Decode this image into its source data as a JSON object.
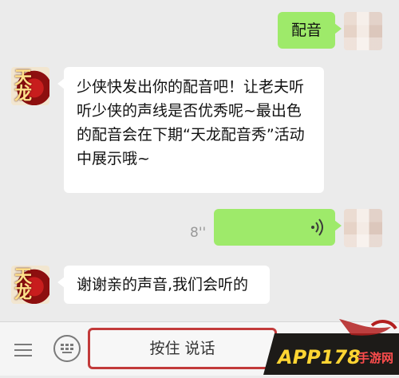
{
  "messages": {
    "m1_text": "配音",
    "m2_text": "少侠快发出你的配音吧！让老夫听听少侠的声线是否优秀呢~最出色的配音会在下期“天龙配音秀”活动中展示哦~",
    "m3_duration": "8''",
    "m4_text": "谢谢亲的声音,我们会听的"
  },
  "avatar": {
    "game_glyph": "天龙"
  },
  "bottom": {
    "hold_to_talk_label": "按住 说话",
    "menu_icon": "menu-icon",
    "keyboard_icon": "keyboard-icon"
  },
  "watermark": {
    "brand": "APP178",
    "suffix": "手游网"
  },
  "colors": {
    "bg": "#ebebeb",
    "green_bubble": "#9eea6a",
    "white_bubble": "#ffffff",
    "button_border": "#c23a3a",
    "wm_dark": "#1d1b18",
    "wm_text": "#ffd533"
  }
}
